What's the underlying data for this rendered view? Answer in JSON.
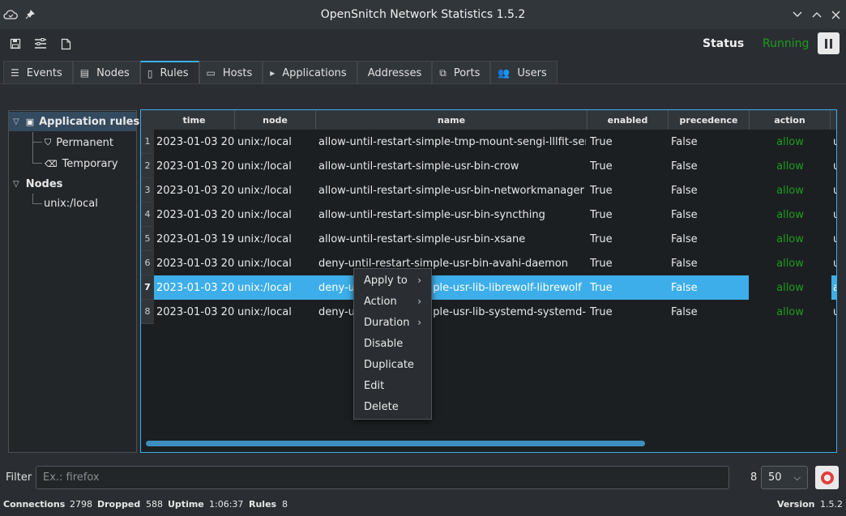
{
  "window": {
    "title": "OpenSnitch Network Statistics 1.5.2",
    "controls": [
      "chevron-down-icon",
      "chevron-up-icon",
      "close-icon"
    ]
  },
  "toolbar": {
    "status_label": "Status",
    "status_value": "Running",
    "status_color": "#1e9c1e",
    "buttons": [
      "save-icon",
      "preferences-icon",
      "new-rule-icon"
    ]
  },
  "tabs": [
    {
      "label": "Events",
      "icon": "list-icon"
    },
    {
      "label": "Nodes",
      "icon": "server-icon"
    },
    {
      "label": "Rules",
      "icon": "rules-icon",
      "active": true
    },
    {
      "label": "Hosts",
      "icon": "monitor-icon"
    },
    {
      "label": "Applications",
      "icon": "application-icon"
    },
    {
      "label": "Addresses",
      "icon": ""
    },
    {
      "label": "Ports",
      "icon": "ports-icon"
    },
    {
      "label": "Users",
      "icon": "users-icon"
    }
  ],
  "tree": {
    "application_rules": "Application rules",
    "permanent": "Permanent",
    "temporary": "Temporary",
    "nodes": "Nodes",
    "node_item": "unix:/local"
  },
  "table": {
    "columns": [
      "time",
      "node",
      "name",
      "enabled",
      "precedence",
      "action"
    ],
    "rows": [
      {
        "num": "1",
        "time": "2023-01-03 20...",
        "node": "unix:/local",
        "name": "allow-until-restart-simple-tmp-mount-sengi-lllfit-sengi",
        "enabled": "True",
        "precedence": "False",
        "action": "allow",
        "extra": "u"
      },
      {
        "num": "2",
        "time": "2023-01-03 20...",
        "node": "unix:/local",
        "name": "allow-until-restart-simple-usr-bin-crow",
        "enabled": "True",
        "precedence": "False",
        "action": "allow",
        "extra": "u"
      },
      {
        "num": "3",
        "time": "2023-01-03 20...",
        "node": "unix:/local",
        "name": "allow-until-restart-simple-usr-bin-networkmanager",
        "enabled": "True",
        "precedence": "False",
        "action": "allow",
        "extra": "u"
      },
      {
        "num": "4",
        "time": "2023-01-03 20...",
        "node": "unix:/local",
        "name": "allow-until-restart-simple-usr-bin-syncthing",
        "enabled": "True",
        "precedence": "False",
        "action": "allow",
        "extra": "u"
      },
      {
        "num": "5",
        "time": "2023-01-03 19...",
        "node": "unix:/local",
        "name": "allow-until-restart-simple-usr-bin-xsane",
        "enabled": "True",
        "precedence": "False",
        "action": "allow",
        "extra": "u"
      },
      {
        "num": "6",
        "time": "2023-01-03 20...",
        "node": "unix:/local",
        "name": "deny-until-restart-simple-usr-bin-avahi-daemon",
        "enabled": "True",
        "precedence": "False",
        "action": "allow",
        "extra": "u"
      },
      {
        "num": "7",
        "time": "2023-01-03 20...",
        "node": "unix:/local",
        "name": "deny-until-restart-simple-usr-lib-librewolf-librewolf",
        "enabled": "True",
        "precedence": "False",
        "action": "allow",
        "extra": "a",
        "selected": true
      },
      {
        "num": "8",
        "time": "2023-01-03 20...",
        "node": "unix:/local",
        "name": "deny-until-restart-simple-usr-lib-systemd-systemd-time...",
        "enabled": "True",
        "precedence": "False",
        "action": "allow",
        "extra": "u"
      }
    ]
  },
  "context_menu": [
    {
      "label": "Apply to",
      "submenu": true
    },
    {
      "label": "Action",
      "submenu": true
    },
    {
      "label": "Duration",
      "submenu": true
    },
    {
      "label": "Disable",
      "submenu": false
    },
    {
      "label": "Duplicate",
      "submenu": false
    },
    {
      "label": "Edit",
      "submenu": false
    },
    {
      "label": "Delete",
      "submenu": false
    }
  ],
  "filter": {
    "label": "Filter",
    "placeholder": "Ex.: firefox",
    "count": "8",
    "limit": "50"
  },
  "statusbar": {
    "connections_label": "Connections",
    "connections": "2798",
    "dropped_label": "Dropped",
    "dropped": "588",
    "uptime_label": "Uptime",
    "uptime": "1:06:37",
    "rules_label": "Rules",
    "rules": "8",
    "version_label": "Version",
    "version": "1.5.2"
  },
  "colors": {
    "accent": "#3daee9",
    "allow": "#1e9c1e"
  }
}
